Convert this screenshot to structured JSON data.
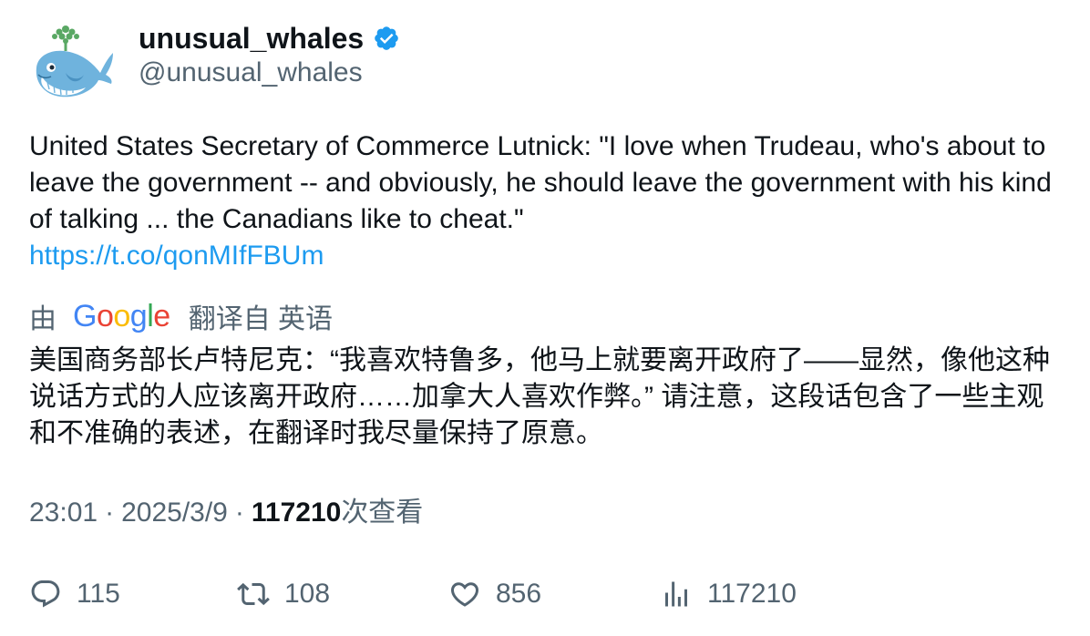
{
  "author": {
    "display_name": "unusual_whales",
    "handle": "@unusual_whales",
    "verified": true,
    "avatar_icon": "whale-logo-icon"
  },
  "tweet": {
    "text": "United States Secretary of Commerce Lutnick: \"I love when Trudeau, who's about to leave the government -- and obviously, he should leave the government with his kind of talking ... the Canadians like to cheat.\"",
    "link": "https://t.co/qonMIfFBUm"
  },
  "translation": {
    "by_label": "由",
    "provider": "Google",
    "suffix": "翻译自 英语",
    "text": "美国商务部长卢特尼克：“我喜欢特鲁多，他马上就要离开政府了——显然，像他这种说话方式的人应该离开政府……加拿大人喜欢作弊。” 请注意，这段话包含了一些主观和不准确的表述，在翻译时我尽量保持了原意。"
  },
  "meta": {
    "time": "23:01",
    "separator": "·",
    "date": "2025/3/9",
    "views_count": "117210",
    "views_label": "次查看"
  },
  "actions": {
    "replies": "115",
    "retweets": "108",
    "likes": "856",
    "views": "117210"
  },
  "colors": {
    "link": "#1d9bf0",
    "secondary_text": "#536471",
    "primary_text": "#0f1419",
    "verified_badge": "#1d9bf0"
  }
}
